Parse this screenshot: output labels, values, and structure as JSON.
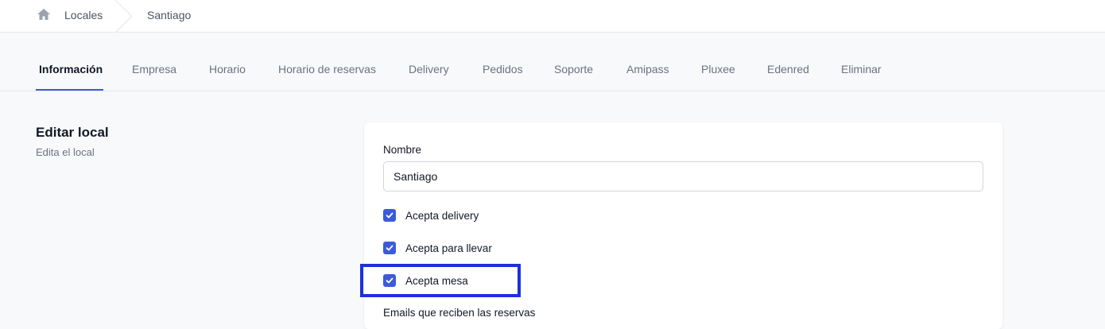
{
  "breadcrumb": {
    "home_icon": "home-icon",
    "items": [
      "Locales",
      "Santiago"
    ]
  },
  "tabs": [
    "Información",
    "Empresa",
    "Horario",
    "Horario de reservas",
    "Delivery",
    "Pedidos",
    "Soporte",
    "Amipass",
    "Pluxee",
    "Edenred",
    "Eliminar"
  ],
  "active_tab": "Información",
  "section": {
    "title": "Editar local",
    "subtitle": "Edita el local"
  },
  "form": {
    "name_label": "Nombre",
    "name_value": "Santiago",
    "checkboxes": [
      {
        "label": "Acepta delivery",
        "checked": true
      },
      {
        "label": "Acepta para llevar",
        "checked": true
      },
      {
        "label": "Acepta mesa",
        "checked": true
      }
    ],
    "emails_label": "Emails que reciben las reservas"
  },
  "colors": {
    "accent": "#3b5bdb",
    "highlight_border": "#1d2fe0"
  }
}
